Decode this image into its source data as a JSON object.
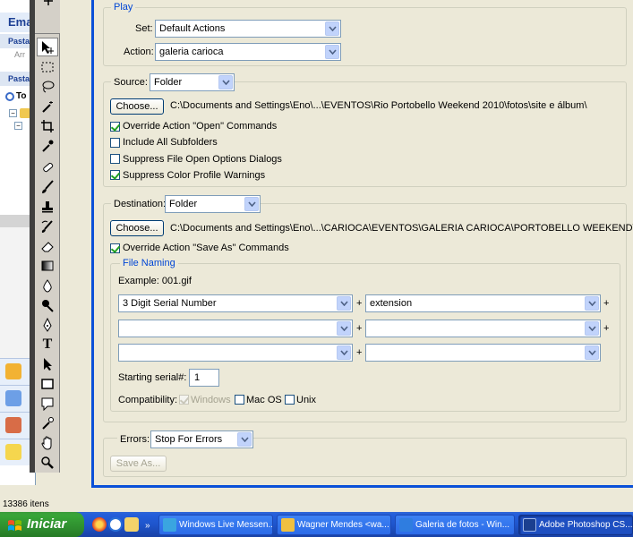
{
  "background_window": {
    "title": "Ema",
    "band1": "Pasta",
    "sub1": "Arr",
    "band2": "Pasta",
    "tree_label": "To",
    "status_text": "13386 itens"
  },
  "toolbar": {
    "tools": [
      "move-tool",
      "marquee-tool",
      "lasso-tool",
      "magic-wand-tool",
      "crop-tool",
      "eyedropper-tool",
      "healing-brush-tool",
      "brush-tool",
      "clone-stamp-tool",
      "history-brush-tool",
      "eraser-tool",
      "gradient-tool",
      "blur-tool",
      "dodge-tool",
      "pen-tool",
      "type-tool",
      "path-selection-tool",
      "shape-tool",
      "notes-tool",
      "eyedropper2-tool",
      "hand-tool",
      "zoom-tool"
    ],
    "type_tool_glyph": "T"
  },
  "dialog": {
    "play": {
      "legend": "Play",
      "set_label": "Set:",
      "set_value": "Default Actions",
      "action_label": "Action:",
      "action_value": "galeria carioca"
    },
    "source": {
      "label": "Source:",
      "value": "Folder",
      "choose_label": "Choose...",
      "path": "C:\\Documents and Settings\\Eno\\...\\EVENTOS\\Rio Portobello Weekend 2010\\fotos\\site e álbum\\",
      "options": [
        {
          "label": "Override Action \"Open\" Commands",
          "checked": true
        },
        {
          "label": "Include All Subfolders",
          "checked": false
        },
        {
          "label": "Suppress File Open Options Dialogs",
          "checked": false
        },
        {
          "label": "Suppress Color Profile Warnings",
          "checked": true
        }
      ]
    },
    "destination": {
      "label": "Destination:",
      "value": "Folder",
      "choose_label": "Choose...",
      "path": "C:\\Documents and Settings\\Eno\\...\\CARIOCA\\EVENTOS\\GALERIA CARIOCA\\PORTOBELLO WEEKEND\\",
      "override_label": "Override Action \"Save As\" Commands",
      "override_checked": true,
      "file_naming": {
        "legend": "File Naming",
        "example": "Example: 001.gif",
        "rows": [
          [
            "3 Digit Serial Number",
            "extension"
          ],
          [
            "",
            ""
          ],
          [
            "",
            ""
          ]
        ],
        "plus": "+",
        "serial_label": "Starting serial#:",
        "serial_value": "1",
        "compat_label": "Compatibility:",
        "compat": [
          {
            "label": "Windows",
            "checked": true,
            "disabled": true
          },
          {
            "label": "Mac OS",
            "checked": false,
            "disabled": false
          },
          {
            "label": "Unix",
            "checked": false,
            "disabled": false
          }
        ]
      }
    },
    "errors": {
      "label": "Errors:",
      "value": "Stop For Errors",
      "save_as_label": "Save As..."
    }
  },
  "taskbar": {
    "start_label": "Iniciar",
    "tasks": [
      {
        "label": "Windows Live Messen...",
        "icon_color": "#3aa5e0"
      },
      {
        "label": "Wagner Mendes <wa...",
        "icon_color": "#f0c040"
      },
      {
        "label": "Galeria de fotos - Win...",
        "icon_color": "#2f7de0"
      },
      {
        "label": "Adobe Photoshop CS...",
        "icon_color": "#1b3f8f"
      }
    ]
  }
}
